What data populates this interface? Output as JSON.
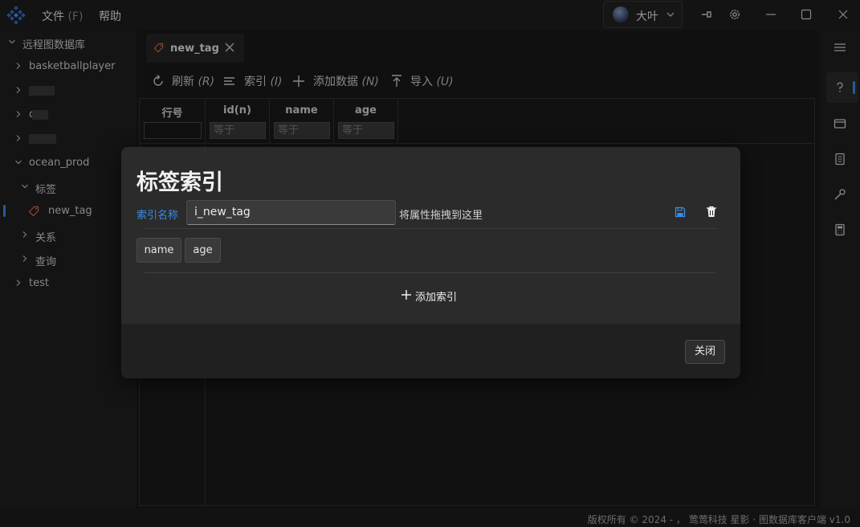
{
  "titlebar": {
    "menu": [
      {
        "label": "文件",
        "hotkey": "(F)"
      },
      {
        "label": "帮助",
        "hotkey": ""
      }
    ],
    "user_name": "大叶"
  },
  "sidebar": {
    "root": "远程图数据库",
    "items": [
      {
        "label": "basketballplayer"
      },
      {
        "label": ""
      },
      {
        "label": "c"
      },
      {
        "label": ""
      },
      {
        "label": "ocean_prod"
      },
      {
        "label": "标签"
      },
      {
        "label": "new_tag"
      },
      {
        "label": "关系"
      },
      {
        "label": "查询"
      },
      {
        "label": "test"
      }
    ]
  },
  "tab": {
    "label": "new_tag"
  },
  "toolbar": {
    "refresh": "刷新",
    "refresh_hk": "(R)",
    "index": "索引",
    "index_hk": "(I)",
    "add_data": "添加数据",
    "add_data_hk": "(N)",
    "import": "导入",
    "import_hk": "(U)"
  },
  "grid": {
    "columns": [
      "行号",
      "id(n)",
      "name",
      "age"
    ],
    "filter_placeholder": "等于"
  },
  "modal": {
    "title": "标签索引",
    "index_name_label": "索引名称",
    "index_name_value": "i_new_tag",
    "drop_hint": "将属性拖拽到这里",
    "fields": [
      "name",
      "age"
    ],
    "add_index": "添加索引",
    "close": "关闭"
  },
  "footer": {
    "copyright": "版权所有 © 2024 - ， 莺莺科技  星影 · 图数据库客户端  v1.0"
  },
  "colors": {
    "accent": "#3a8de6",
    "tag_icon": "#d9734a"
  }
}
